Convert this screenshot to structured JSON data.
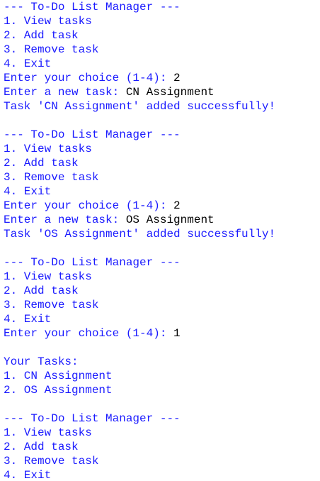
{
  "colors": {
    "output_text": "#1a1aff",
    "user_input": "#000000",
    "background": "#ffffff"
  },
  "lines": [
    {
      "text": "--- To-Do List Manager ---"
    },
    {
      "text": "1. View tasks"
    },
    {
      "text": "2. Add task"
    },
    {
      "text": "3. Remove task"
    },
    {
      "text": "4. Exit"
    },
    {
      "text": "Enter your choice (1-4): ",
      "input": "2"
    },
    {
      "text": "Enter a new task: ",
      "input": "CN Assignment"
    },
    {
      "text": "Task 'CN Assignment' added successfully!"
    },
    {
      "text": ""
    },
    {
      "text": "--- To-Do List Manager ---"
    },
    {
      "text": "1. View tasks"
    },
    {
      "text": "2. Add task"
    },
    {
      "text": "3. Remove task"
    },
    {
      "text": "4. Exit"
    },
    {
      "text": "Enter your choice (1-4): ",
      "input": "2"
    },
    {
      "text": "Enter a new task: ",
      "input": "OS Assignment"
    },
    {
      "text": "Task 'OS Assignment' added successfully!"
    },
    {
      "text": ""
    },
    {
      "text": "--- To-Do List Manager ---"
    },
    {
      "text": "1. View tasks"
    },
    {
      "text": "2. Add task"
    },
    {
      "text": "3. Remove task"
    },
    {
      "text": "4. Exit"
    },
    {
      "text": "Enter your choice (1-4): ",
      "input": "1"
    },
    {
      "text": ""
    },
    {
      "text": "Your Tasks:"
    },
    {
      "text": "1. CN Assignment"
    },
    {
      "text": "2. OS Assignment"
    },
    {
      "text": ""
    },
    {
      "text": "--- To-Do List Manager ---"
    },
    {
      "text": "1. View tasks"
    },
    {
      "text": "2. Add task"
    },
    {
      "text": "3. Remove task"
    },
    {
      "text": "4. Exit"
    }
  ]
}
